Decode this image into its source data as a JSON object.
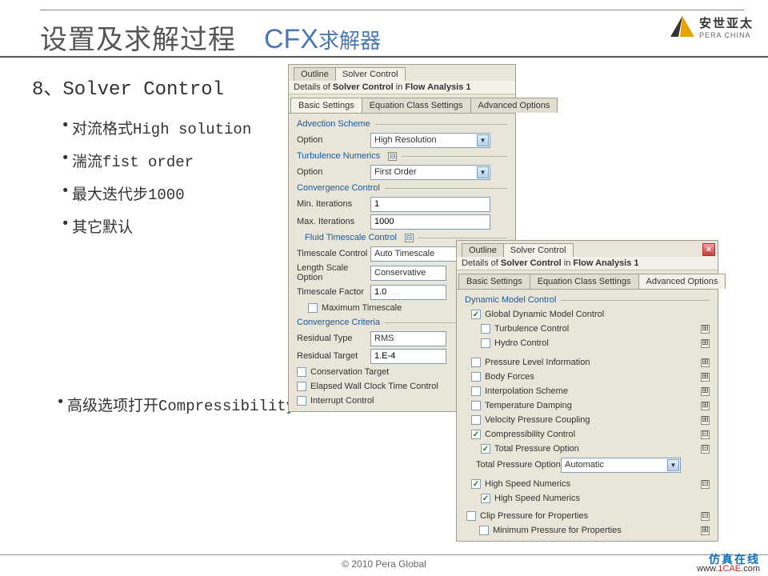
{
  "header": {
    "title_main": "设置及求解过程",
    "title_cfx": "CFX",
    "title_sub": "求解器",
    "logo_cn": "安世亚太",
    "logo_en": "PERA CHINA"
  },
  "content": {
    "step_title": "8、Solver Control",
    "bullets": [
      "对流格式High solution",
      "湍流fist order",
      "最大迭代步1000",
      "其它默认"
    ],
    "adv_line": "高级选项打开Compressibility Control"
  },
  "panel_basic": {
    "tab_outline": "Outline",
    "tab_solver": "Solver Control",
    "details_prefix": "Details of ",
    "details_bold": "Solver Control",
    "details_in": " in ",
    "details_flow": "Flow Analysis 1",
    "sub_tabs": [
      "Basic Settings",
      "Equation Class Settings",
      "Advanced Options"
    ],
    "grp_adv": "Advection Scheme",
    "lbl_option": "Option",
    "val_advection": "High Resolution",
    "grp_turb": "Turbulence Numerics",
    "val_turb": "First Order",
    "grp_conv": "Convergence Control",
    "lbl_min_iter": "Min. Iterations",
    "val_min_iter": "1",
    "lbl_max_iter": "Max. Iterations",
    "val_max_iter": "1000",
    "grp_fluid": "Fluid Timescale Control",
    "lbl_ts_ctrl": "Timescale Control",
    "val_ts_ctrl": "Auto Timescale",
    "lbl_length": "Length Scale Option",
    "val_length": "Conservative",
    "lbl_ts_factor": "Timescale Factor",
    "val_ts_factor": "1.0",
    "chk_max_ts": "Maximum Timescale",
    "grp_crit": "Convergence Criteria",
    "lbl_res_type": "Residual Type",
    "val_res_type": "RMS",
    "lbl_res_target": "Residual Target",
    "val_res_target": "1.E-4",
    "chk_cons_target": "Conservation Target",
    "chk_elapsed": "Elapsed Wall Clock Time Control",
    "chk_interrupt": "Interrupt Control"
  },
  "panel_adv": {
    "tab_outline": "Outline",
    "tab_solver": "Solver Control",
    "details_prefix": "Details of ",
    "details_bold": "Solver Control",
    "details_in": " in ",
    "details_flow": "Flow Analysis 1",
    "sub_tabs": [
      "Basic Settings",
      "Equation Class Settings",
      "Advanced Options"
    ],
    "grp_dyn": "Dynamic Model Control",
    "chk_global": "Global Dynamic Model Control",
    "chk_turb_ctrl": "Turbulence Control",
    "chk_hydro": "Hydro Control",
    "chk_press_level": "Pressure Level Information",
    "chk_body_forces": "Body Forces",
    "chk_interp": "Interpolation Scheme",
    "chk_temp_damp": "Temperature Damping",
    "chk_vel_press": "Velocity Pressure Coupling",
    "chk_compress": "Compressibility Control",
    "chk_total_press_opt": "Total Pressure Option",
    "lbl_total_press": "Total Pressure Option",
    "val_total_press": "Automatic",
    "chk_hsnum1": "High Speed Numerics",
    "chk_hsnum2": "High Speed Numerics",
    "chk_clip": "Clip Pressure for Properties",
    "chk_min_press": "Minimum Pressure for Properties"
  },
  "footer": {
    "copyright": "© 2010 Pera Global",
    "badge_l1": "仿真在线",
    "badge_l2_pre": "www.",
    "badge_l2_mid": "1CAE",
    "badge_l2_post": ".com"
  }
}
